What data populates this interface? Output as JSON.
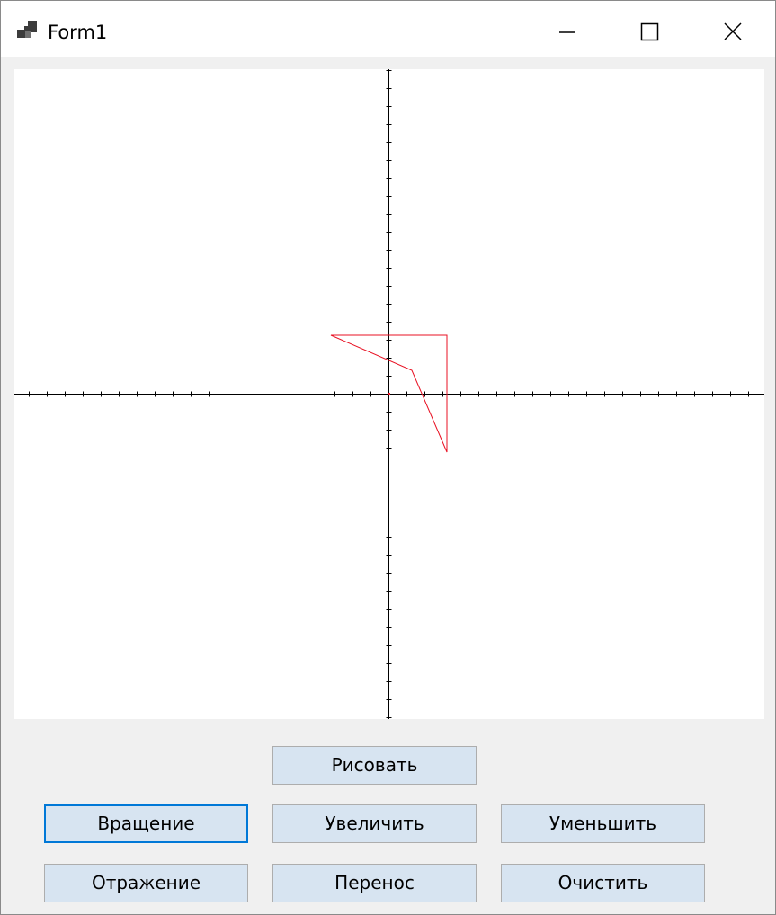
{
  "window": {
    "title": "Form1",
    "app_icon": "winforms-app-icon",
    "controls": {
      "minimize_icon": "minimize-icon",
      "maximize_icon": "maximize-icon",
      "close_icon": "close-icon"
    }
  },
  "buttons": {
    "draw": "Рисовать",
    "rotate": "Вращение",
    "zoom_in": "Увеличить",
    "zoom_out": "Уменьшить",
    "reflect": "Отражение",
    "translate": "Перенос",
    "clear": "Очистить"
  },
  "colors": {
    "shape_stroke": "#e81123",
    "axis": "#000000",
    "button_face": "#d7e4f1",
    "focus_border": "#0078d7"
  }
}
